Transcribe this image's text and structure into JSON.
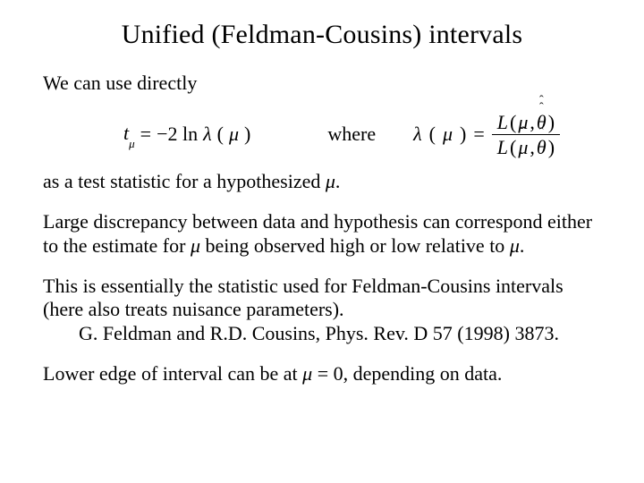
{
  "title": "Unified (Feldman-Cousins) intervals",
  "p1": "We can use directly",
  "eq": {
    "lhs_var": "t",
    "lhs_sub": "μ",
    "eq_sign": "=",
    "minus2ln": "−2 ln ",
    "lambda": "λ",
    "lparen": "(",
    "mu": "μ",
    "rparen": ")",
    "where": "where",
    "num_L": "L",
    "num_mu": "μ",
    "comma": ", ",
    "theta": "θ",
    "hat": "ˆ",
    "den_L": "L",
    "den_mu": "μ",
    "den_theta": "θ"
  },
  "p2a": "as a test statistic for a hypothesized ",
  "p2b": "μ",
  "p2c": ".",
  "p3a": "Large discrepancy between data and hypothesis can correspond either to the estimate for ",
  "p3b": "μ",
  "p3c": " being observed high or low relative to ",
  "p3d": "μ",
  "p3e": ".",
  "p4": "This is essentially the statistic used for Feldman-Cousins intervals (here also treats nuisance parameters).",
  "p4ref": "G. Feldman and R.D. Cousins, Phys. Rev. D 57 (1998) 3873.",
  "p5a": "Lower edge of interval can be at ",
  "p5b": "μ",
  "p5c": " = 0, depending on data."
}
